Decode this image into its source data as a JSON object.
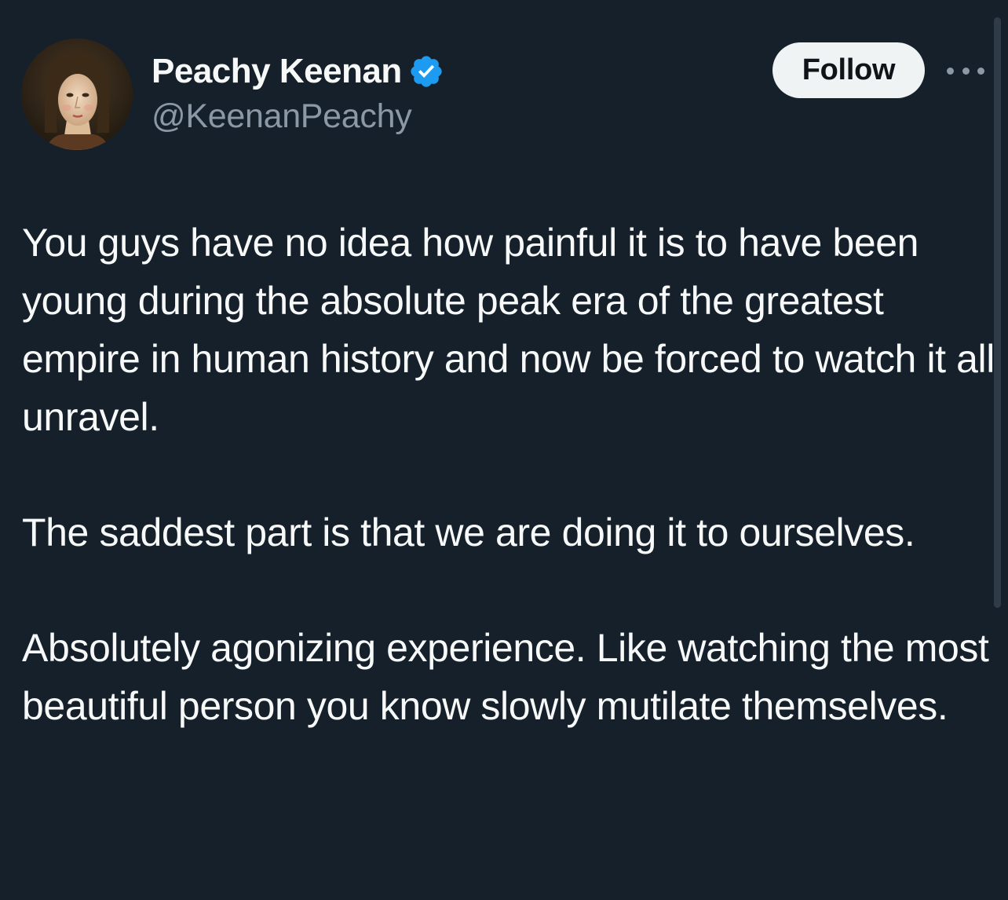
{
  "author": {
    "display_name": "Peachy Keenan",
    "handle": "@KeenanPeachy",
    "verified": true,
    "avatar": "renaissance-portrait-avatar"
  },
  "actions": {
    "follow_label": "Follow",
    "more_icon": "more-horizontal-icon"
  },
  "tweet": {
    "paragraphs": [
      "You guys have no idea how painful it is to have been young during the absolute peak era of the greatest empire in human history and now be forced to watch it all unravel.",
      "The saddest part is that we are doing it to ourselves.",
      "Absolutely agonizing experience. Like watching the most beautiful person you know slowly mutilate themselves."
    ]
  },
  "colors": {
    "background": "#15202b",
    "text_primary": "#f7f9f9",
    "text_secondary": "#8b98a5",
    "verified_badge": "#1d9bf0",
    "follow_button_bg": "#eff3f4",
    "follow_button_text": "#0f1419"
  }
}
